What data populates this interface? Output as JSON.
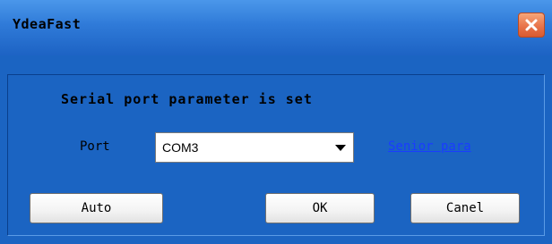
{
  "window": {
    "title": "YdeaFast"
  },
  "dialog": {
    "heading": "Serial port parameter is set",
    "port_label": "Port",
    "port_value": "COM3",
    "senior_link": "Senior para"
  },
  "buttons": {
    "auto": "Auto",
    "ok": "OK",
    "cancel": "Canel"
  },
  "icons": {
    "close": "close-icon",
    "dropdown": "chevron-down-icon"
  },
  "colors": {
    "window_bg": "#1b64c2",
    "close_button": "#e8744a",
    "link": "#1a3cff"
  }
}
